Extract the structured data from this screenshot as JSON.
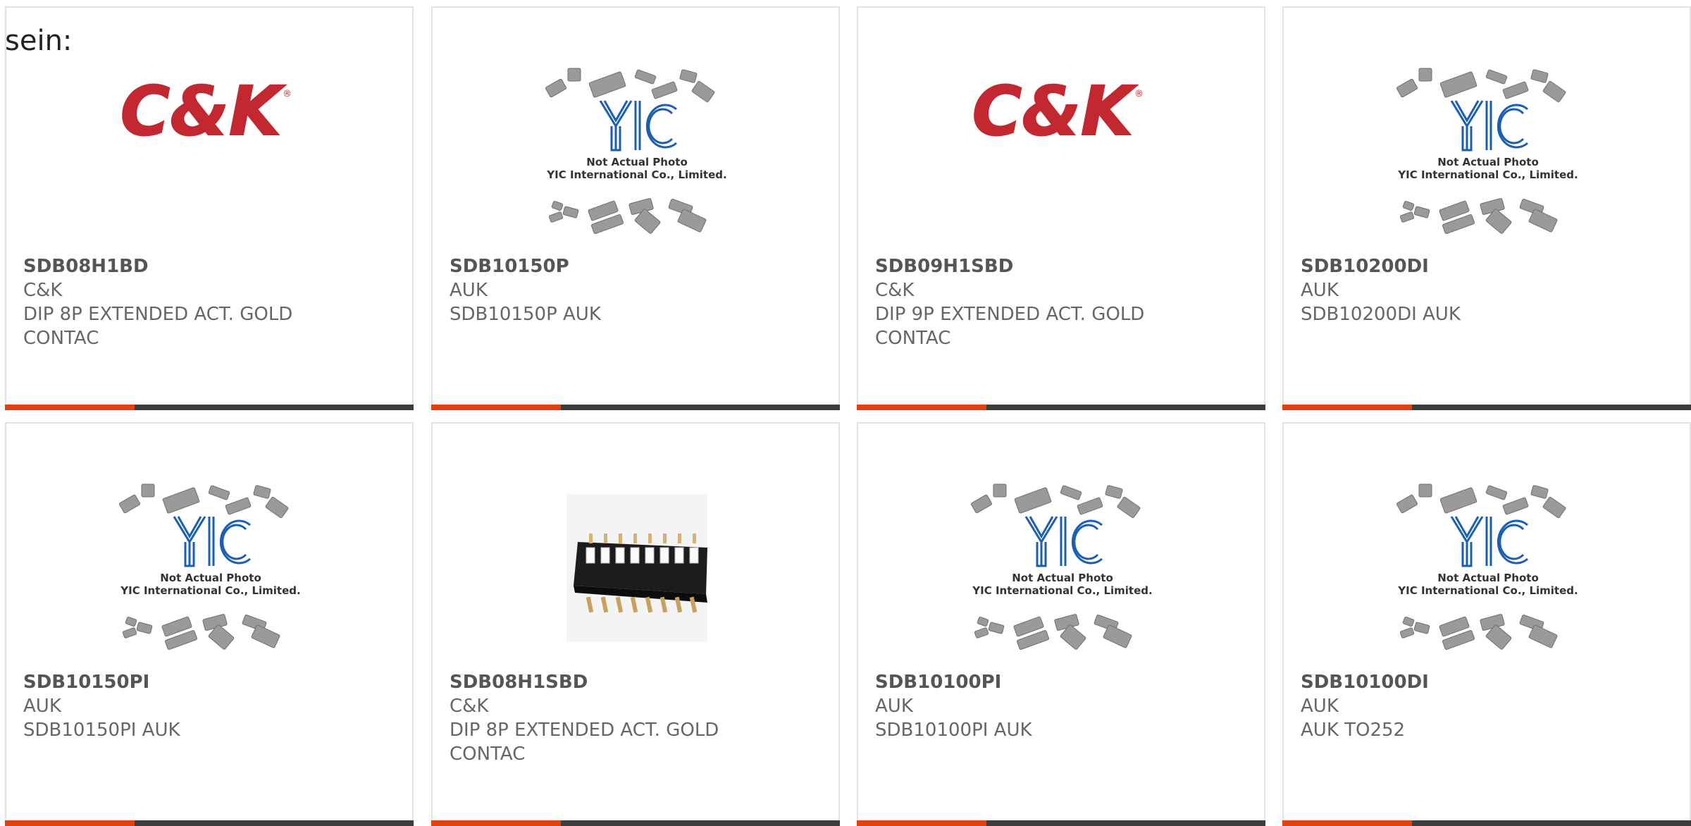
{
  "intro_text": "sein:",
  "colors": {
    "accent": "#e2400f",
    "bar": "#3c3c3c",
    "card_border": "#e2e2e2",
    "ck_red": "#c3272f",
    "ck_black": "#1a1a1a",
    "yic_blue": "#1a5fb0"
  },
  "placeholder": {
    "line1": "Not Actual Photo",
    "line2": "YIC International Co., Limited."
  },
  "ck_logo": {
    "text": "C&K",
    "mark": "®"
  },
  "products": [
    {
      "part_number": "SDB08H1BD",
      "manufacturer": "C&K",
      "description": "DIP 8P EXTENDED ACT. GOLD CONTAC",
      "image": "ck-logo"
    },
    {
      "part_number": "SDB10150P",
      "manufacturer": "AUK",
      "description": "SDB10150P AUK",
      "image": "yic-placeholder"
    },
    {
      "part_number": "SDB09H1SBD",
      "manufacturer": "C&K",
      "description": "DIP 9P EXTENDED ACT. GOLD CONTAC",
      "image": "ck-logo"
    },
    {
      "part_number": "SDB10200DI",
      "manufacturer": "AUK",
      "description": "SDB10200DI AUK",
      "image": "yic-placeholder"
    },
    {
      "part_number": "SDB10150PI",
      "manufacturer": "AUK",
      "description": "SDB10150PI AUK",
      "image": "yic-placeholder"
    },
    {
      "part_number": "SDB08H1SBD",
      "manufacturer": "C&K",
      "description": "DIP 8P EXTENDED ACT. GOLD CONTAC",
      "image": "dip-switch-photo"
    },
    {
      "part_number": "SDB10100PI",
      "manufacturer": "AUK",
      "description": "SDB10100PI AUK",
      "image": "yic-placeholder"
    },
    {
      "part_number": "SDB10100DI",
      "manufacturer": "AUK",
      "description": "AUK TO252",
      "image": "yic-placeholder"
    }
  ]
}
